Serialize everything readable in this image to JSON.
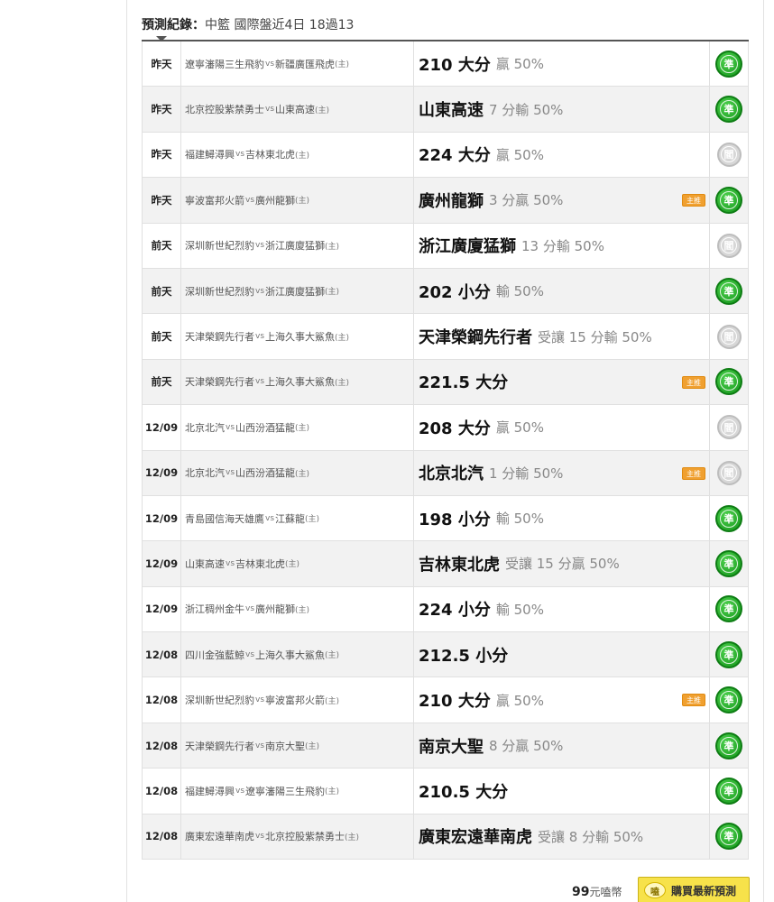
{
  "header": {
    "label": "預測紀錄：",
    "summary": "中籃 國際盤近4日 18過13"
  },
  "rows": [
    {
      "date": "昨天",
      "away": "遼寧瀋陽三生飛豹",
      "home": "新疆廣匯飛虎",
      "pick": "210 大分",
      "detail": "贏 50%",
      "badge": false,
      "status": "win"
    },
    {
      "date": "昨天",
      "away": "北京控股紫禁勇士",
      "home": "山東高速",
      "pick": "山東高速",
      "detail": "7 分輸 50%",
      "badge": false,
      "status": "win"
    },
    {
      "date": "昨天",
      "away": "福建鱘潯興",
      "home": "吉林東北虎",
      "pick": "224 大分",
      "detail": "贏 50%",
      "badge": false,
      "status": "lose"
    },
    {
      "date": "昨天",
      "away": "寧波富邦火箭",
      "home": "廣州龍獅",
      "pick": "廣州龍獅",
      "detail": "3 分贏 50%",
      "badge": true,
      "status": "win"
    },
    {
      "date": "前天",
      "away": "深圳新世紀烈豹",
      "home": "浙江廣廈猛獅",
      "pick": "浙江廣廈猛獅",
      "detail": "13 分輸 50%",
      "badge": false,
      "status": "lose"
    },
    {
      "date": "前天",
      "away": "深圳新世紀烈豹",
      "home": "浙江廣廈猛獅",
      "pick": "202 小分",
      "detail": "輸 50%",
      "badge": false,
      "status": "win"
    },
    {
      "date": "前天",
      "away": "天津榮鋼先行者",
      "home": "上海久事大鯊魚",
      "pick": "天津榮鋼先行者",
      "detail": "受讓 15 分輸 50%",
      "badge": false,
      "status": "lose"
    },
    {
      "date": "前天",
      "away": "天津榮鋼先行者",
      "home": "上海久事大鯊魚",
      "pick": "221.5 大分",
      "detail": "",
      "badge": true,
      "status": "win"
    },
    {
      "date": "12/09",
      "away": "北京北汽",
      "home": "山西汾酒猛龍",
      "pick": "208 大分",
      "detail": "贏 50%",
      "badge": false,
      "status": "lose"
    },
    {
      "date": "12/09",
      "away": "北京北汽",
      "home": "山西汾酒猛龍",
      "pick": "北京北汽",
      "detail": "1 分輸 50%",
      "badge": true,
      "status": "lose"
    },
    {
      "date": "12/09",
      "away": "青島國信海天雄鷹",
      "home": "江蘇龍",
      "pick": "198 小分",
      "detail": "輸 50%",
      "badge": false,
      "status": "win"
    },
    {
      "date": "12/09",
      "away": "山東高速",
      "home": "吉林東北虎",
      "pick": "吉林東北虎",
      "detail": "受讓 15 分贏 50%",
      "badge": false,
      "status": "win"
    },
    {
      "date": "12/09",
      "away": "浙江稠州金牛",
      "home": "廣州龍獅",
      "pick": "224 小分",
      "detail": "輸 50%",
      "badge": false,
      "status": "win"
    },
    {
      "date": "12/08",
      "away": "四川金強藍鯨",
      "home": "上海久事大鯊魚",
      "pick": "212.5 小分",
      "detail": "",
      "badge": false,
      "status": "win"
    },
    {
      "date": "12/08",
      "away": "深圳新世紀烈豹",
      "home": "寧波富邦火箭",
      "pick": "210 大分",
      "detail": "贏 50%",
      "badge": true,
      "status": "win"
    },
    {
      "date": "12/08",
      "away": "天津榮鋼先行者",
      "home": "南京大聖",
      "pick": "南京大聖",
      "detail": "8 分贏 50%",
      "badge": false,
      "status": "win"
    },
    {
      "date": "12/08",
      "away": "福建鱘潯興",
      "home": "遼寧瀋陽三生飛豹",
      "pick": "210.5 大分",
      "detail": "",
      "badge": false,
      "status": "win"
    },
    {
      "date": "12/08",
      "away": "廣東宏遠華南虎",
      "home": "北京控股紫禁勇士",
      "pick": "廣東宏遠華南虎",
      "detail": "受讓 8 分輸 50%",
      "badge": false,
      "status": "win"
    }
  ],
  "labels": {
    "vs": "vs",
    "host": "(主)",
    "badge": "主推",
    "win_glyph": "準",
    "lose_glyph": "閻"
  },
  "footer": {
    "price_num": "99",
    "price_unit": "元嗑幣",
    "buy_label": "購買最新預測",
    "coin_glyph": "嗑"
  },
  "colors": {
    "win": "#13951a",
    "lose": "#d7d7d7",
    "badge": "#f0a030",
    "buy_button": "#f7e24a"
  }
}
